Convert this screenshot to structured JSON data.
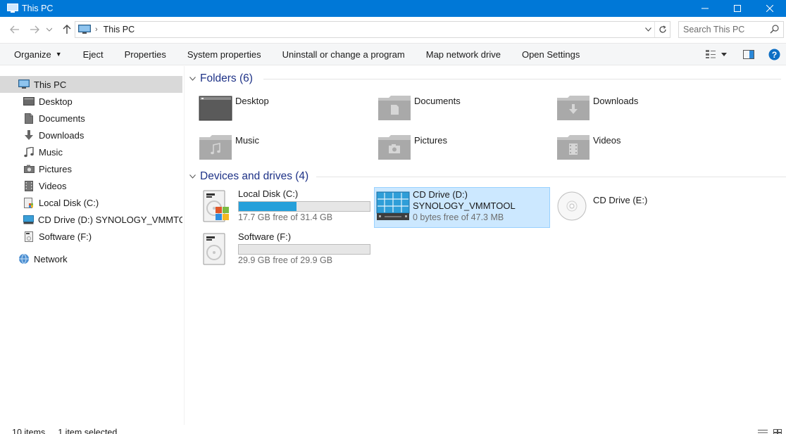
{
  "window": {
    "title": "This PC",
    "controls": [
      "minimize",
      "maximize",
      "close"
    ]
  },
  "address": {
    "path": "This PC",
    "search_placeholder": "Search This PC"
  },
  "commands": [
    {
      "label": "Organize",
      "has_menu": true
    },
    {
      "label": "Eject"
    },
    {
      "label": "Properties"
    },
    {
      "label": "System properties"
    },
    {
      "label": "Uninstall or change a program"
    },
    {
      "label": "Map network drive"
    },
    {
      "label": "Open Settings"
    }
  ],
  "nav": {
    "this_pc": "This PC",
    "items": [
      {
        "label": "Desktop",
        "icon": "desktop-icon"
      },
      {
        "label": "Documents",
        "icon": "document-icon"
      },
      {
        "label": "Downloads",
        "icon": "download-icon"
      },
      {
        "label": "Music",
        "icon": "music-icon"
      },
      {
        "label": "Pictures",
        "icon": "camera-icon"
      },
      {
        "label": "Videos",
        "icon": "film-icon"
      },
      {
        "label": "Local Disk (C:)",
        "icon": "hard-disk-icon"
      },
      {
        "label": "CD Drive (D:) SYNOLOGY_VMMTOOL",
        "icon": "cd-drive-icon"
      },
      {
        "label": "Software (F:)",
        "icon": "hard-disk-icon"
      }
    ],
    "network": "Network"
  },
  "folders": {
    "header": "Folders (6)",
    "items": [
      {
        "label": "Desktop",
        "icon": "desktop-folder-icon"
      },
      {
        "label": "Documents",
        "icon": "documents-folder-icon"
      },
      {
        "label": "Downloads",
        "icon": "downloads-folder-icon"
      },
      {
        "label": "Music",
        "icon": "music-folder-icon"
      },
      {
        "label": "Pictures",
        "icon": "pictures-folder-icon"
      },
      {
        "label": "Videos",
        "icon": "videos-folder-icon"
      }
    ]
  },
  "drives": {
    "header": "Devices and drives (4)",
    "items": [
      {
        "name": "Local Disk (C:)",
        "free": "17.7 GB free of 31.4 GB",
        "used_fraction": 0.44,
        "icon": "windows-disk-icon"
      },
      {
        "name": "CD Drive (D:)",
        "volume": "SYNOLOGY_VMMTOOL",
        "free": "0 bytes free of 47.3 MB",
        "selected": true,
        "icon": "server-disc-icon"
      },
      {
        "name": "CD Drive (E:)",
        "icon": "empty-disc-icon"
      },
      {
        "name": "Software (F:)",
        "free": "29.9 GB free of 29.9 GB",
        "used_fraction": 0.0,
        "icon": "hard-disk-icon"
      }
    ]
  },
  "status": {
    "items": "10 items",
    "selected": "1 item selected"
  },
  "colors": {
    "titlebar": "#0078d7",
    "accent_bar": "#26a0da",
    "selection": "#cce8ff",
    "group_header": "#1e3287"
  }
}
